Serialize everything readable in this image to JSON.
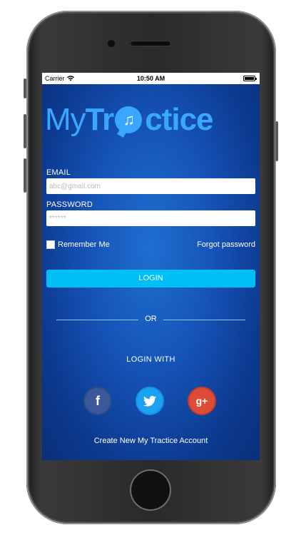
{
  "status_bar": {
    "carrier": "Carrier",
    "time": "10:50 AM"
  },
  "logo": {
    "part1": "My",
    "part2": "Tr",
    "part3": "ctice",
    "badge_symbol": "♫"
  },
  "form": {
    "email_label": "EMAIL",
    "email_placeholder": "abc@gmail.com",
    "password_label": "PASSWORD",
    "password_placeholder": "******",
    "remember_label": "Remember Me",
    "forgot_label": "Forgot password",
    "login_label": "LOGIN"
  },
  "divider": {
    "text": "OR"
  },
  "social": {
    "title": "LOGIN WITH",
    "facebook_glyph": "f",
    "google_glyph": "g+"
  },
  "footer": {
    "create_account": "Create New My Tractice Account"
  },
  "colors": {
    "accent": "#00bff5",
    "background": "#1654b8",
    "facebook": "#3b5998",
    "twitter": "#1da1f2",
    "google": "#dd4b39"
  }
}
